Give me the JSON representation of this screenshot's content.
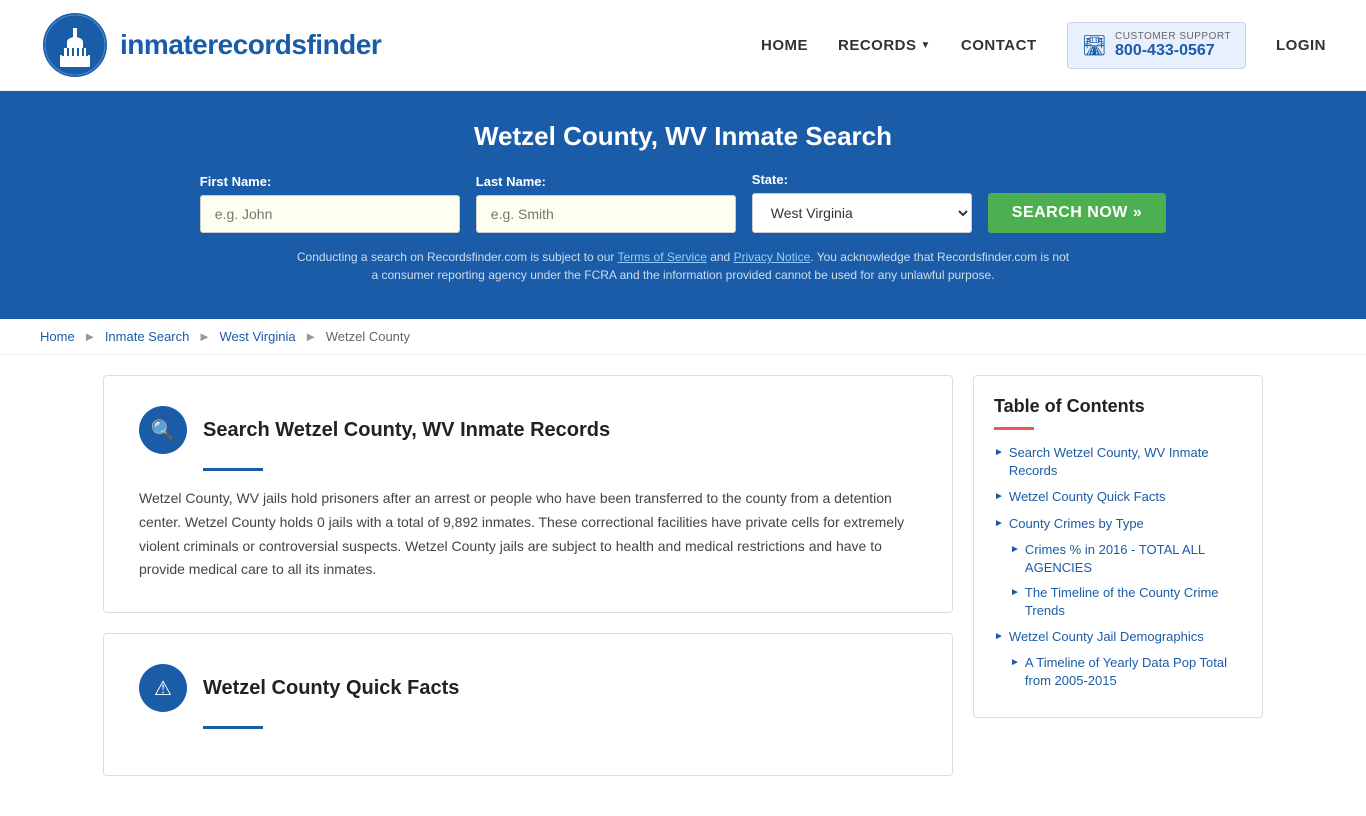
{
  "site": {
    "logo_text_normal": "inmaterecords",
    "logo_text_bold": "finder"
  },
  "nav": {
    "home": "HOME",
    "records": "RECORDS",
    "contact": "CONTACT",
    "support_label": "CUSTOMER SUPPORT",
    "support_number": "800-433-0567",
    "login": "LOGIN"
  },
  "hero": {
    "title": "Wetzel County, WV Inmate Search",
    "first_name_label": "First Name:",
    "first_name_placeholder": "e.g. John",
    "last_name_label": "Last Name:",
    "last_name_placeholder": "e.g. Smith",
    "state_label": "State:",
    "state_value": "West Virginia",
    "search_button": "SEARCH NOW »",
    "disclaimer": "Conducting a search on Recordsfinder.com is subject to our Terms of Service and Privacy Notice. You acknowledge that Recordsfinder.com is not a consumer reporting agency under the FCRA and the information provided cannot be used for any unlawful purpose.",
    "tos_link": "Terms of Service",
    "privacy_link": "Privacy Notice"
  },
  "breadcrumb": {
    "home": "Home",
    "inmate_search": "Inmate Search",
    "state": "West Virginia",
    "county": "Wetzel County"
  },
  "content": {
    "section1_title": "Search Wetzel County, WV Inmate Records",
    "section1_body": "Wetzel County, WV jails hold prisoners after an arrest or people who have been transferred to the county from a detention center. Wetzel County holds 0 jails with a total of 9,892 inmates. These correctional facilities have private cells for extremely violent criminals or controversial suspects. Wetzel County jails are subject to health and medical restrictions and have to provide medical care to all its inmates.",
    "section2_title": "Wetzel County Quick Facts"
  },
  "toc": {
    "title": "Table of Contents",
    "items": [
      {
        "label": "Search Wetzel County, WV Inmate Records",
        "sub": false
      },
      {
        "label": "Wetzel County Quick Facts",
        "sub": false
      },
      {
        "label": "County Crimes by Type",
        "sub": false
      },
      {
        "label": "Crimes % in 2016 - TOTAL ALL AGENCIES",
        "sub": true
      },
      {
        "label": "The Timeline of the County Crime Trends",
        "sub": true
      },
      {
        "label": "Wetzel County Jail Demographics",
        "sub": false
      },
      {
        "label": "A Timeline of Yearly Data Pop Total from 2005-2015",
        "sub": true
      }
    ]
  }
}
